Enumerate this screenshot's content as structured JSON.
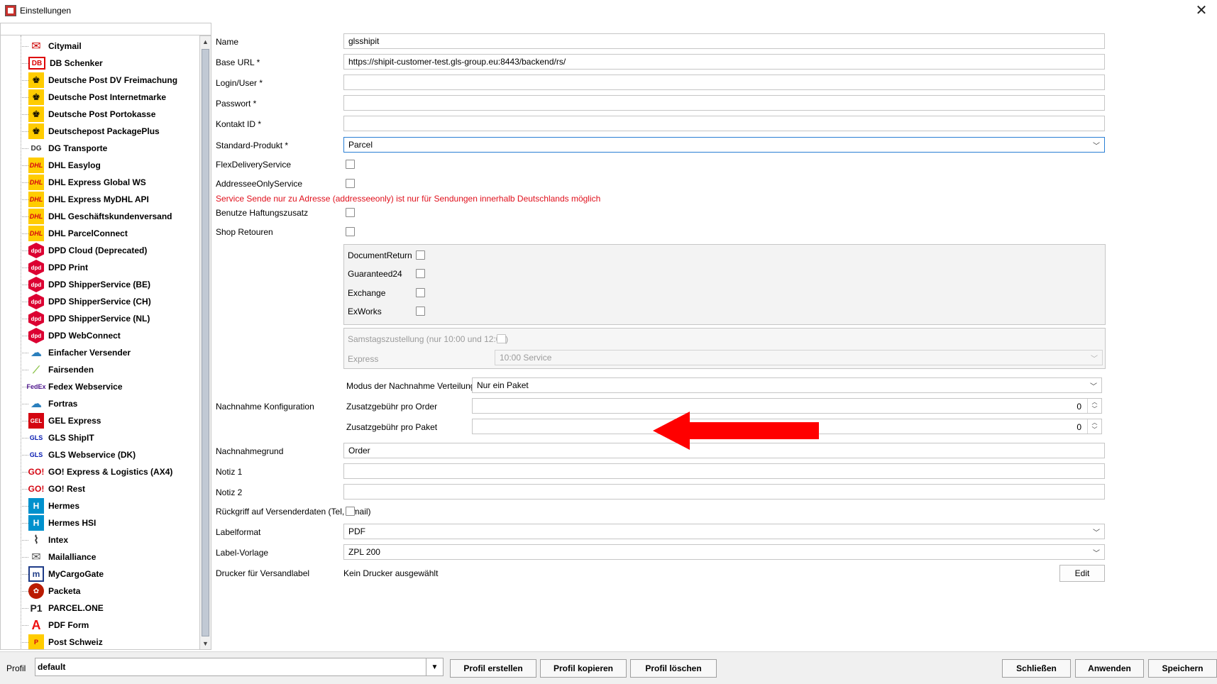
{
  "window": {
    "title": "Einstellungen",
    "close_glyph": "✕"
  },
  "tree": {
    "items": [
      {
        "label": "Citymail",
        "icon": "envelope-icon",
        "glyph": "✉",
        "cls": "mail"
      },
      {
        "label": "DB Schenker",
        "icon": "db-logo-icon",
        "glyph": "DB",
        "cls": "db"
      },
      {
        "label": "Deutsche Post DV Freimachung",
        "icon": "post-horn-icon",
        "glyph": "♚",
        "cls": "dp"
      },
      {
        "label": "Deutsche Post Internetmarke",
        "icon": "post-horn-icon",
        "glyph": "♚",
        "cls": "dp"
      },
      {
        "label": "Deutsche Post Portokasse",
        "icon": "post-horn-icon",
        "glyph": "♚",
        "cls": "dp"
      },
      {
        "label": "Deutschepost PackagePlus",
        "icon": "post-horn-icon",
        "glyph": "♚",
        "cls": "dp"
      },
      {
        "label": "DG Transporte",
        "icon": "dg-logo-icon",
        "glyph": "DG",
        "cls": "dg"
      },
      {
        "label": "DHL Easylog",
        "icon": "dhl-logo-icon",
        "glyph": "DHL",
        "cls": "dhl"
      },
      {
        "label": "DHL Express Global WS",
        "icon": "dhl-logo-icon",
        "glyph": "DHL",
        "cls": "dhl"
      },
      {
        "label": "DHL Express MyDHL API",
        "icon": "dhl-logo-icon",
        "glyph": "DHL",
        "cls": "dhl"
      },
      {
        "label": "DHL Geschäftskundenversand",
        "icon": "dhl-logo-icon",
        "glyph": "DHL",
        "cls": "dhl"
      },
      {
        "label": "DHL ParcelConnect",
        "icon": "dhl-logo-icon",
        "glyph": "DHL",
        "cls": "dhl"
      },
      {
        "label": "DPD Cloud (Deprecated)",
        "icon": "dpd-cube-icon",
        "glyph": "dpd",
        "cls": "dpd"
      },
      {
        "label": "DPD Print",
        "icon": "dpd-cube-icon",
        "glyph": "dpd",
        "cls": "dpd"
      },
      {
        "label": "DPD ShipperService (BE)",
        "icon": "dpd-cube-icon",
        "glyph": "dpd",
        "cls": "dpd"
      },
      {
        "label": "DPD ShipperService (CH)",
        "icon": "dpd-cube-icon",
        "glyph": "dpd",
        "cls": "dpd"
      },
      {
        "label": "DPD ShipperService (NL)",
        "icon": "dpd-cube-icon",
        "glyph": "dpd",
        "cls": "dpd"
      },
      {
        "label": "DPD WebConnect",
        "icon": "dpd-cube-icon",
        "glyph": "dpd",
        "cls": "dpd"
      },
      {
        "label": "Einfacher Versender",
        "icon": "cloud-icon",
        "glyph": "☁",
        "cls": "cloud"
      },
      {
        "label": "Fairsenden",
        "icon": "leaf-icon",
        "glyph": "⟋",
        "cls": "fair"
      },
      {
        "label": "Fedex Webservice",
        "icon": "fedex-logo-icon",
        "glyph": "FedEx",
        "cls": "fedex"
      },
      {
        "label": "Fortras",
        "icon": "cloud-icon",
        "glyph": "☁",
        "cls": "cloud"
      },
      {
        "label": "GEL Express",
        "icon": "gel-logo-icon",
        "glyph": "GEL",
        "cls": "gel"
      },
      {
        "label": "GLS ShipIT",
        "icon": "gls-logo-icon",
        "glyph": "GLS",
        "cls": "gls"
      },
      {
        "label": "GLS Webservice (DK)",
        "icon": "gls-logo-icon",
        "glyph": "GLS",
        "cls": "gls"
      },
      {
        "label": "GO! Express & Logistics (AX4)",
        "icon": "go-logo-icon",
        "glyph": "GO!",
        "cls": "go"
      },
      {
        "label": "GO! Rest",
        "icon": "go-logo-icon",
        "glyph": "GO!",
        "cls": "go"
      },
      {
        "label": "Hermes",
        "icon": "hermes-logo-icon",
        "glyph": "H",
        "cls": "hermes"
      },
      {
        "label": "Hermes HSI",
        "icon": "hermes-logo-icon",
        "glyph": "H",
        "cls": "hermes"
      },
      {
        "label": "Intex",
        "icon": "intex-logo-icon",
        "glyph": "⌇",
        "cls": "intex"
      },
      {
        "label": "Mailalliance",
        "icon": "envelope-icon",
        "glyph": "✉",
        "cls": "mailall"
      },
      {
        "label": "MyCargoGate",
        "icon": "mycargogate-logo-icon",
        "glyph": "m",
        "cls": "mycargo"
      },
      {
        "label": "Packeta",
        "icon": "packeta-logo-icon",
        "glyph": "✿",
        "cls": "packeta"
      },
      {
        "label": "PARCEL.ONE",
        "icon": "parcel-one-logo-icon",
        "glyph": "P1",
        "cls": "parcel"
      },
      {
        "label": "PDF Form",
        "icon": "pdf-icon",
        "glyph": "A",
        "cls": "pdf"
      },
      {
        "label": "Post Schweiz",
        "icon": "post-schweiz-logo-icon",
        "glyph": "P",
        "cls": "ps"
      }
    ]
  },
  "form": {
    "name_label": "Name",
    "name_value": "glsshipit",
    "baseurl_label": "Base URL *",
    "baseurl_value": "https://shipit-customer-test.gls-group.eu:8443/backend/rs/",
    "login_label": "Login/User *",
    "login_value": "",
    "password_label": "Passwort *",
    "password_value": "",
    "kontakt_label": "Kontakt ID *",
    "kontakt_value": "",
    "produkt_label": "Standard-Produkt *",
    "produkt_value": "Parcel",
    "flex_label": "FlexDeliveryService",
    "addressee_label": "AddresseeOnlyService",
    "warning_text": "Service Sende nur zu Adresse (addresseeonly) ist nur für Sendungen innerhalb Deutschlands möglich",
    "haftung_label": "Benutze Haftungszusatz",
    "retouren_label": "Shop Retouren",
    "retouren_options": {
      "document_return": "DocumentReturn",
      "guaranteed24": "Guaranteed24",
      "exchange": "Exchange",
      "exworks": "ExWorks"
    },
    "samstag_label": "Samstagszustellung (nur 10:00 und 12:00)",
    "express_label": "Express",
    "express_value": "10:00 Service",
    "nachnahme_label": "Nachnahme Konfiguration",
    "modus_label": "Modus der Nachnahme Verteilung",
    "modus_value": "Nur ein Paket",
    "gebuehr_order_label": "Zusatzgebühr pro Order",
    "gebuehr_order_value": "0",
    "gebuehr_paket_label": "Zusatzgebühr pro Paket",
    "gebuehr_paket_value": "0",
    "grund_label": "Nachnahmegrund",
    "grund_value": "Order",
    "notiz1_label": "Notiz 1",
    "notiz1_value": "",
    "notiz2_label": "Notiz 2",
    "notiz2_value": "",
    "rueckgriff_label": "Rückgriff auf Versenderdaten (Tel, Email)",
    "labelformat_label": "Labelformat",
    "labelformat_value": "PDF",
    "vorlage_label": "Label-Vorlage",
    "vorlage_value": "ZPL 200",
    "drucker_label": "Drucker für Versandlabel",
    "drucker_value": "Kein Drucker ausgewählt",
    "edit_label": "Edit"
  },
  "bottom": {
    "profil_label": "Profil",
    "profil_value": "default",
    "create_label": "Profil erstellen",
    "copy_label": "Profil kopieren",
    "delete_label": "Profil löschen",
    "close_label": "Schließen",
    "apply_label": "Anwenden",
    "save_label": "Speichern"
  },
  "colors": {
    "warning": "#e0101c",
    "arrow": "#ff0000",
    "focus": "#2a7fd4"
  }
}
